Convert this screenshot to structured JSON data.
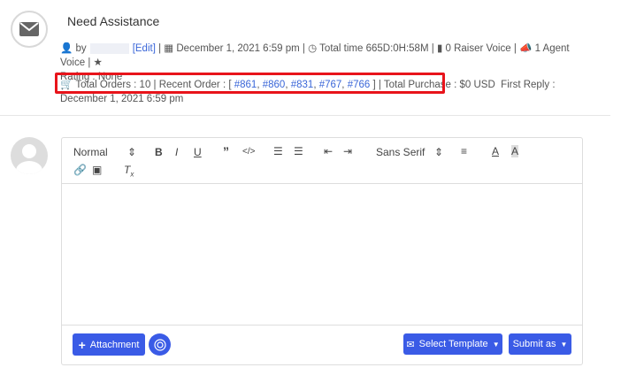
{
  "ticket": {
    "title": "Need Assistance"
  },
  "meta": {
    "by": "by",
    "edit": "[Edit]",
    "date": "December 1, 2021 6:59 pm",
    "total_time": "Total time 665D:0H:58M",
    "raiser_voice": "0 Raiser Voice",
    "agent_voice": "1 Agent Voice",
    "rating": "Rating : None"
  },
  "orders": {
    "total_orders": "Total Orders : 10",
    "recent_label": "Recent Order : [",
    "recent": [
      "#861",
      "#860",
      "#831",
      "#767",
      "#766"
    ],
    "recent_end": "]",
    "total_purchase": "Total Purchase : $0 USD",
    "first_reply": "First Reply : December 1, 2021 6:59 pm"
  },
  "toolbar": {
    "format": "Normal",
    "font": "Sans Serif"
  },
  "footer": {
    "attachment": "Attachment",
    "select_template": "Select Template",
    "submit_as": "Submit as"
  },
  "colors": {
    "accent": "#3a5be6",
    "highlight": "#e8141b",
    "link": "#3a66d8"
  }
}
